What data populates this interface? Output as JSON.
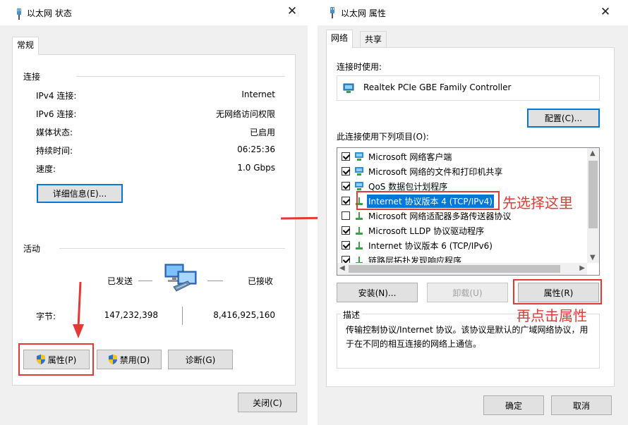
{
  "left_window": {
    "title": "以太网 状态",
    "tab": "常规",
    "connection": {
      "group_title": "连接",
      "rows": [
        {
          "label": "IPv4 连接:",
          "value": "Internet"
        },
        {
          "label": "IPv6 连接:",
          "value": "无网络访问权限"
        },
        {
          "label": "媒体状态:",
          "value": "已启用"
        },
        {
          "label": "持续时间:",
          "value": "06:25:36"
        },
        {
          "label": "速度:",
          "value": "1.0 Gbps"
        }
      ],
      "details_button": "详细信息(E)..."
    },
    "activity": {
      "group_title": "活动",
      "sent_label": "已发送",
      "received_label": "已接收",
      "bytes_label": "字节:",
      "bytes_sent": "147,232,398",
      "bytes_received": "8,416,925,160"
    },
    "buttons": {
      "properties": "属性(P)",
      "disable": "禁用(D)",
      "diagnose": "诊断(G)",
      "close": "关闭(C)"
    }
  },
  "right_window": {
    "title": "以太网 属性",
    "tabs": [
      "网络",
      "共享"
    ],
    "connect_using_label": "连接时使用:",
    "adapter_name": "Realtek PCIe GBE Family Controller",
    "configure_button": "配置(C)...",
    "items_label": "此连接使用下列项目(O):",
    "items": [
      {
        "label": "Microsoft 网络客户端",
        "checked": true,
        "icon": "network-client-icon"
      },
      {
        "label": "Microsoft 网络的文件和打印机共享",
        "checked": true,
        "icon": "file-share-icon"
      },
      {
        "label": "QoS 数据包计划程序",
        "checked": true,
        "icon": "qos-icon"
      },
      {
        "label": "Internet 协议版本 4 (TCP/IPv4)",
        "checked": true,
        "icon": "protocol-icon",
        "selected": true
      },
      {
        "label": "Microsoft 网络适配器多路传送器协议",
        "checked": false,
        "icon": "protocol-icon"
      },
      {
        "label": "Microsoft LLDP 协议驱动程序",
        "checked": true,
        "icon": "protocol-icon"
      },
      {
        "label": "Internet 协议版本 6 (TCP/IPv6)",
        "checked": true,
        "icon": "protocol-icon"
      },
      {
        "label": "链路层拓扑发现响应程序",
        "checked": true,
        "icon": "protocol-icon"
      }
    ],
    "buttons": {
      "install": "安装(N)...",
      "uninstall": "卸载(U)",
      "properties": "属性(R)",
      "ok": "确定",
      "cancel": "取消"
    },
    "description_title": "描述",
    "description_text": "传输控制协议/Internet 协议。该协议是默认的广域网络协议，用于在不同的相互连接的网络上通信。"
  },
  "annotations": {
    "first_note": "先选择这里",
    "second_note": "再点击属性",
    "color": "#e53935"
  }
}
